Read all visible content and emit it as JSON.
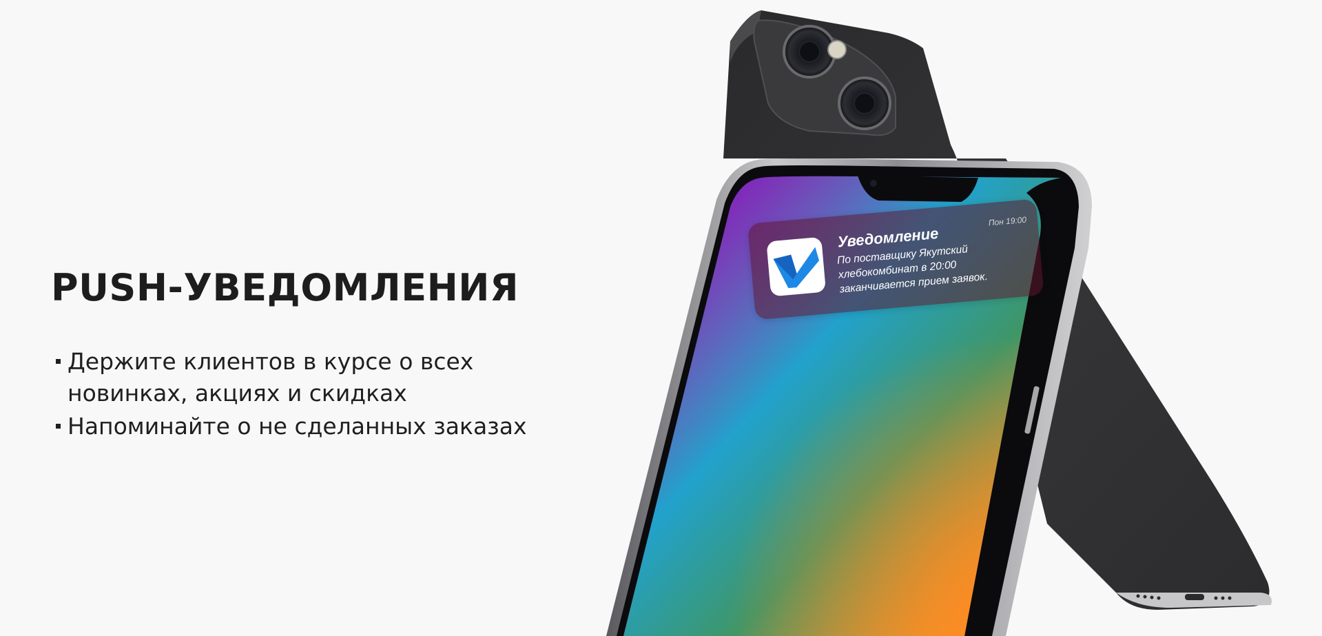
{
  "title": "PUSH-УВЕДОМЛЕНИЯ",
  "bullets": [
    "Держите клиентов в курсе о всех новинках, акциях и скидках",
    "Напоминайте о не сделанных заказах"
  ],
  "notification": {
    "title": "Уведомление",
    "time": "Пон 19:00",
    "body": "По поставщику Якутский хлебокомбинат в 20:00 заканчивается прием заявок.",
    "icon": "checkmark-icon"
  },
  "colors": {
    "background": "#f8f8f8",
    "text": "#1d1d1d",
    "check_blue": "#1e88e5",
    "phone_body": "#2e2e30"
  }
}
